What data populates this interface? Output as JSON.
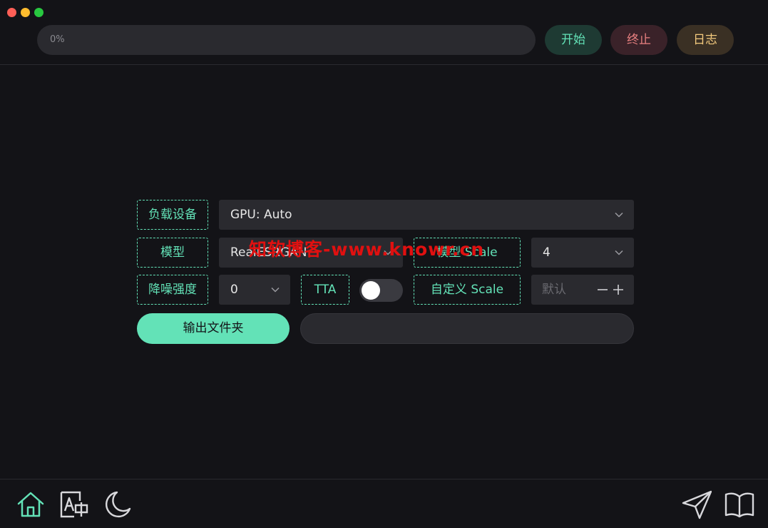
{
  "window": {
    "buttons": [
      "close",
      "minimize",
      "zoom"
    ]
  },
  "topbar": {
    "progress": {
      "value": 0,
      "text": "0%"
    },
    "start_label": "开始",
    "stop_label": "终止",
    "log_label": "日志"
  },
  "form": {
    "device": {
      "label": "负载设备",
      "value": "GPU: Auto"
    },
    "model": {
      "label": "模型",
      "value": "RealESRGAN"
    },
    "model_scale": {
      "label": "模型 Scale",
      "value": "4"
    },
    "denoise": {
      "label": "降噪强度",
      "value": "0"
    },
    "tta": {
      "label": "TTA",
      "enabled": false
    },
    "custom_scale": {
      "label": "自定义 Scale",
      "placeholder": "默认"
    },
    "output": {
      "button_label": "输出文件夹",
      "path": ""
    }
  },
  "watermark": "知软博客-www.knowr.cn",
  "bottom_nav": {
    "left": [
      "home-icon",
      "translate-icon",
      "moon-icon"
    ],
    "right": [
      "send-icon",
      "book-icon"
    ]
  },
  "colors": {
    "accent": "#63e2b7",
    "danger": "#e88080",
    "warning": "#f2c97d",
    "background": "#131317",
    "surface": "#2a2a2f"
  }
}
